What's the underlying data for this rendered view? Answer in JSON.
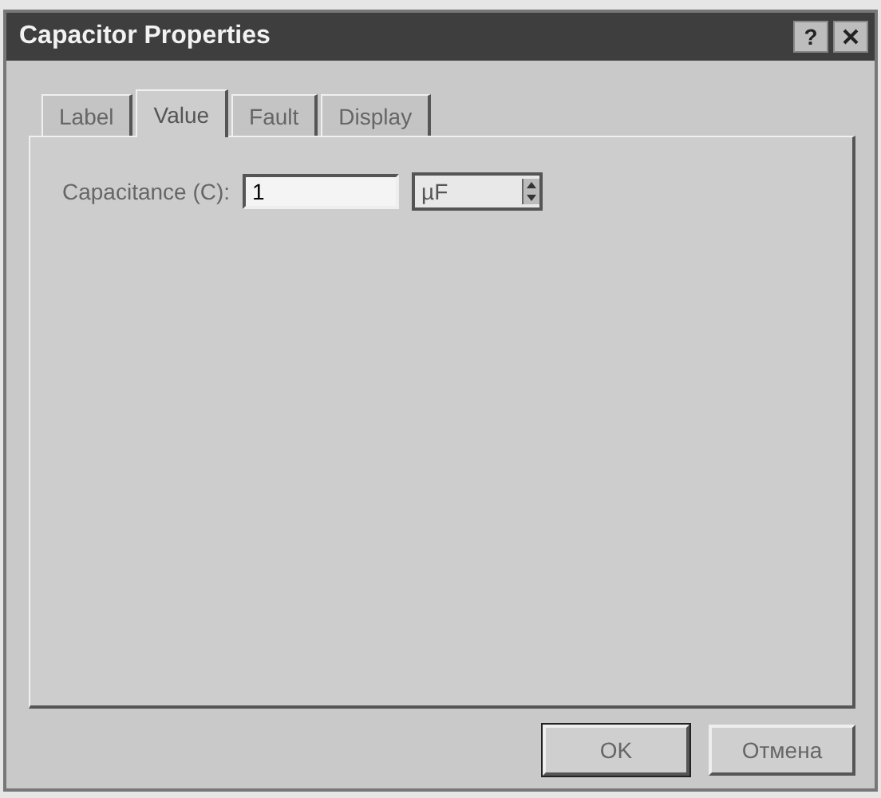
{
  "window": {
    "title": "Capacitor Properties",
    "help": "?"
  },
  "tabs": [
    {
      "label": "Label",
      "selected": false
    },
    {
      "label": "Value",
      "selected": true
    },
    {
      "label": "Fault",
      "selected": false
    },
    {
      "label": "Display",
      "selected": false
    }
  ],
  "fields": [
    {
      "label": "Capacitance (C):",
      "value": "1",
      "unit": "µF"
    }
  ],
  "buttons": [
    {
      "label": "OK",
      "default": true
    },
    {
      "label": "Отмена",
      "default": false
    }
  ]
}
